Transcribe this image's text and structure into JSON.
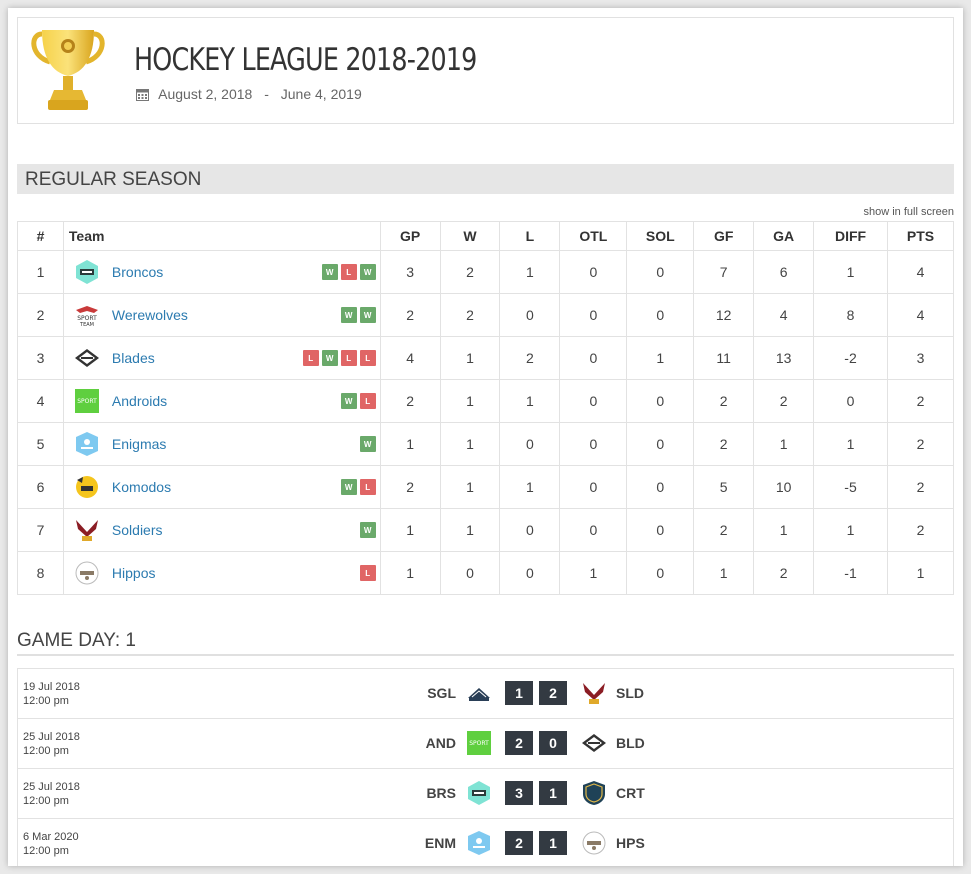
{
  "league": {
    "title": "HOCKEY LEAGUE 2018-2019",
    "start_date": "August 2, 2018",
    "separator": "-",
    "end_date": "June 4, 2019"
  },
  "section_title": "REGULAR SEASON",
  "fullscreen_link": "show in full screen",
  "columns": [
    "#",
    "Team",
    "GP",
    "W",
    "L",
    "OTL",
    "SOL",
    "GF",
    "GA",
    "DIFF",
    "PTS"
  ],
  "standings": [
    {
      "pos": "1",
      "team": "Broncos",
      "logo": "broncos-logo",
      "form": [
        "W",
        "L",
        "W"
      ],
      "gp": "3",
      "w": "2",
      "l": "1",
      "otl": "0",
      "sol": "0",
      "gf": "7",
      "ga": "6",
      "diff": "1",
      "pts": "4"
    },
    {
      "pos": "2",
      "team": "Werewolves",
      "logo": "werewolves-logo",
      "form": [
        "W",
        "W"
      ],
      "gp": "2",
      "w": "2",
      "l": "0",
      "otl": "0",
      "sol": "0",
      "gf": "12",
      "ga": "4",
      "diff": "8",
      "pts": "4"
    },
    {
      "pos": "3",
      "team": "Blades",
      "logo": "blades-logo",
      "form": [
        "L",
        "W",
        "L",
        "L"
      ],
      "gp": "4",
      "w": "1",
      "l": "2",
      "otl": "0",
      "sol": "1",
      "gf": "11",
      "ga": "13",
      "diff": "-2",
      "pts": "3"
    },
    {
      "pos": "4",
      "team": "Androids",
      "logo": "androids-logo",
      "form": [
        "W",
        "L"
      ],
      "gp": "2",
      "w": "1",
      "l": "1",
      "otl": "0",
      "sol": "0",
      "gf": "2",
      "ga": "2",
      "diff": "0",
      "pts": "2"
    },
    {
      "pos": "5",
      "team": "Enigmas",
      "logo": "enigmas-logo",
      "form": [
        "W"
      ],
      "gp": "1",
      "w": "1",
      "l": "0",
      "otl": "0",
      "sol": "0",
      "gf": "2",
      "ga": "1",
      "diff": "1",
      "pts": "2"
    },
    {
      "pos": "6",
      "team": "Komodos",
      "logo": "komodos-logo",
      "form": [
        "W",
        "L"
      ],
      "gp": "2",
      "w": "1",
      "l": "1",
      "otl": "0",
      "sol": "0",
      "gf": "5",
      "ga": "10",
      "diff": "-5",
      "pts": "2"
    },
    {
      "pos": "7",
      "team": "Soldiers",
      "logo": "soldiers-logo",
      "form": [
        "W"
      ],
      "gp": "1",
      "w": "1",
      "l": "0",
      "otl": "0",
      "sol": "0",
      "gf": "2",
      "ga": "1",
      "diff": "1",
      "pts": "2"
    },
    {
      "pos": "8",
      "team": "Hippos",
      "logo": "hippos-logo",
      "form": [
        "L"
      ],
      "gp": "1",
      "w": "0",
      "l": "0",
      "otl": "1",
      "sol": "0",
      "gf": "1",
      "ga": "2",
      "diff": "-1",
      "pts": "1"
    }
  ],
  "gameday_title": "GAME DAY: 1",
  "games": [
    {
      "date": "19 Jul 2018",
      "time": "12:00 pm",
      "home": "SGL",
      "home_logo": "sgl-logo",
      "home_score": "1",
      "away_score": "2",
      "away": "SLD",
      "away_logo": "soldiers-logo"
    },
    {
      "date": "25 Jul 2018",
      "time": "12:00 pm",
      "home": "AND",
      "home_logo": "androids-logo",
      "home_score": "2",
      "away_score": "0",
      "away": "BLD",
      "away_logo": "blades-logo"
    },
    {
      "date": "25 Jul 2018",
      "time": "12:00 pm",
      "home": "BRS",
      "home_logo": "broncos-logo",
      "home_score": "3",
      "away_score": "1",
      "away": "CRT",
      "away_logo": "crt-logo"
    },
    {
      "date": "6 Mar 2020",
      "time": "12:00 pm",
      "home": "ENM",
      "home_logo": "enigmas-logo",
      "home_score": "2",
      "away_score": "1",
      "away": "HPS",
      "away_logo": "hippos-logo"
    }
  ],
  "colors": {
    "win": "#6aa96a",
    "loss": "#e06565",
    "link": "#2c7bb0",
    "score_bg": "#333a42"
  }
}
